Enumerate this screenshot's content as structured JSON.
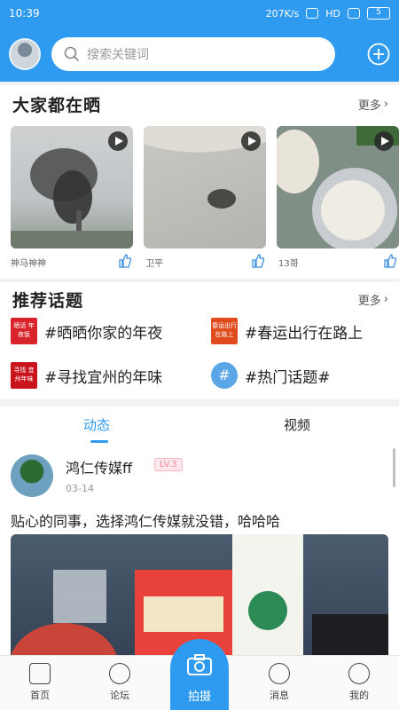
{
  "status": {
    "time": "10:39",
    "speed": "207K/s",
    "network": "HD",
    "battery": "5"
  },
  "search": {
    "placeholder": "搜索关键词"
  },
  "share": {
    "title": "大家都在晒",
    "more": "更多",
    "items": [
      {
        "caption": "神马神神"
      },
      {
        "caption": "卫平"
      },
      {
        "caption": "13哥"
      }
    ]
  },
  "topics": {
    "title": "推荐话题",
    "more": "更多",
    "items": [
      {
        "label": "#晒晒你家的年夜",
        "img_text": "晒话 年夜饭"
      },
      {
        "label": "#春运出行在路上",
        "img_text": "春运出行 在路上"
      },
      {
        "label": "#寻找宜州的年味",
        "img_text": "寻找 宜州年味"
      },
      {
        "label": "#热门话题#",
        "img_text": "#"
      }
    ]
  },
  "tabs": {
    "active": "动态",
    "other": "视频"
  },
  "post": {
    "author": "鸿仁传媒ff",
    "level": "LV.3",
    "date": "03-14",
    "text": "贴心的同事，选择鸿仁传媒就没错，哈哈哈"
  },
  "nav": {
    "home": "首页",
    "forum": "论坛",
    "camera": "拍摄",
    "messages": "消息",
    "mine": "我的"
  },
  "colors": {
    "accent": "#2f9bf0",
    "level_badge": "#f48ba5"
  }
}
